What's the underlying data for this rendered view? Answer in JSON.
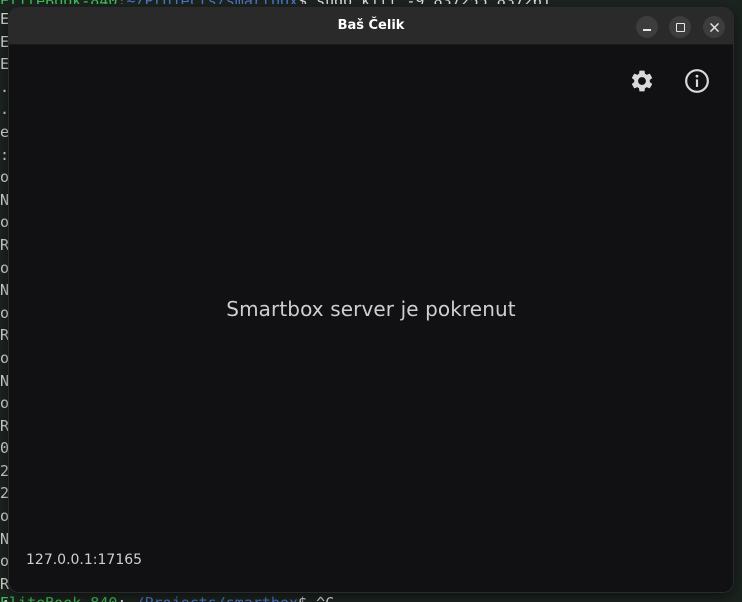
{
  "window": {
    "title": "Baš Čelik"
  },
  "toolbar": {
    "settings_icon": "gear-icon",
    "info_icon": "info-icon"
  },
  "main": {
    "status": "Smartbox server je pokrenut",
    "address": "127.0.0.1:17165"
  },
  "colors": {
    "window_bg": "#111114",
    "titlebar_bg": "#2a2a2a",
    "text": "#cfcfcf"
  }
}
